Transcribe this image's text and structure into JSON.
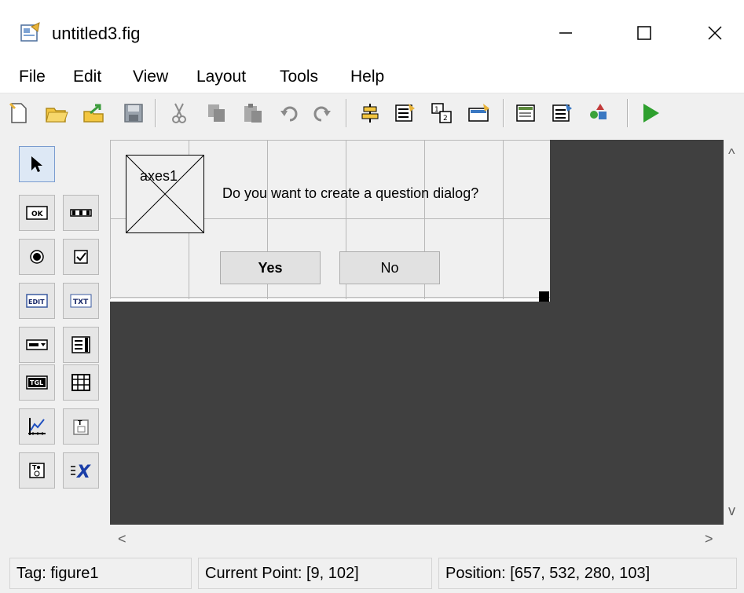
{
  "window": {
    "title": "untitled3.fig",
    "minimize_glyph": "—",
    "maximize_glyph": "☐",
    "close_glyph": "✕"
  },
  "menu": [
    "File",
    "Edit",
    "View",
    "Layout",
    "Tools",
    "Help"
  ],
  "toolbar": {
    "icons": [
      "new-file-icon",
      "open-folder-icon",
      "export-icon",
      "save-icon",
      "cut-icon",
      "copy-icon",
      "paste-icon",
      "undo-icon",
      "redo-icon",
      "align-icon",
      "menu-editor-icon",
      "tab-order-icon",
      "toolbar-editor-icon",
      "editor-icon",
      "property-inspector-icon",
      "object-browser-icon",
      "run-icon"
    ]
  },
  "palette": {
    "items": [
      {
        "name": "select-tool",
        "glyph": "➤"
      },
      {
        "name": "push-button-tool",
        "glyph": "OK"
      },
      {
        "name": "slider-tool",
        "glyph": "▭"
      },
      {
        "name": "radio-button-tool",
        "glyph": "◉"
      },
      {
        "name": "checkbox-tool",
        "glyph": "☑"
      },
      {
        "name": "edit-text-tool",
        "glyph": "EDIT"
      },
      {
        "name": "static-text-tool",
        "glyph": "TXT"
      },
      {
        "name": "popup-menu-tool",
        "glyph": "▭▾"
      },
      {
        "name": "listbox-tool",
        "glyph": "☰"
      },
      {
        "name": "toggle-button-tool",
        "glyph": "TGL"
      },
      {
        "name": "table-tool",
        "glyph": "▦"
      },
      {
        "name": "axes-tool",
        "glyph": "📈"
      },
      {
        "name": "panel-tool",
        "glyph": "T"
      },
      {
        "name": "button-group-tool",
        "glyph": "T"
      },
      {
        "name": "activex-tool",
        "glyph": "X"
      }
    ]
  },
  "figure": {
    "axes_label": "axes1",
    "question": "Do you want to create a question dialog?",
    "yes_label": "Yes",
    "no_label": "No"
  },
  "scroll": {
    "up": "^",
    "down": "v",
    "left": "<",
    "right": ">"
  },
  "status": {
    "tag": "Tag: figure1",
    "current_point": "Current Point:  [9, 102]",
    "position": "Position: [657, 532, 280, 103]"
  }
}
